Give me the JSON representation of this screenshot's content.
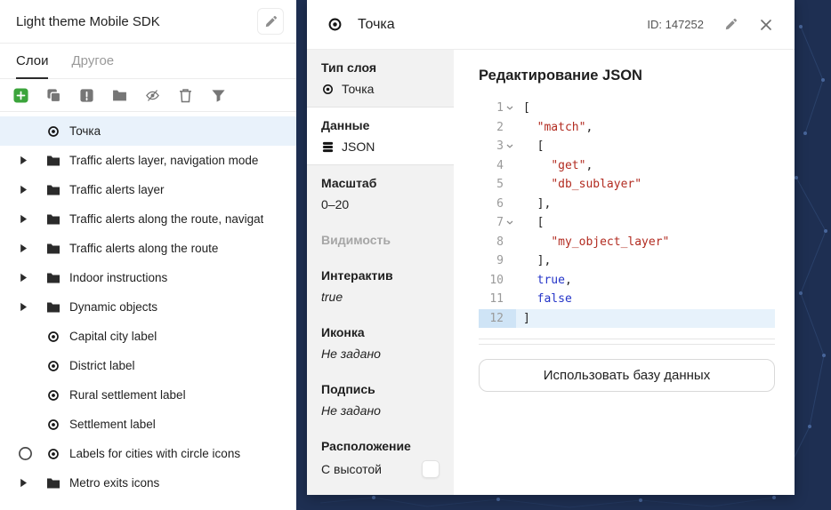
{
  "colors": {
    "bg": "#1e2f52",
    "selection": "#e9f2fb",
    "accent-green": "#3ba43b",
    "string": "#b22b20",
    "keyword": "#2434c8",
    "active-line": "#e7f2fb",
    "active-gutter": "#cfe4f6"
  },
  "left_panel": {
    "title": "Light theme Mobile SDK",
    "tabs": [
      {
        "name": "layers",
        "label": "Слои",
        "active": true
      },
      {
        "name": "other",
        "label": "Другое",
        "active": false
      }
    ],
    "toolbar_icons": [
      "add-icon",
      "duplicate-icon",
      "alert-square-icon",
      "group-folder-icon",
      "eye-off-icon",
      "trash-icon",
      "filter-icon"
    ],
    "layers": [
      {
        "type": "point",
        "label": "Точка",
        "selected": true
      },
      {
        "type": "folder",
        "label": "Traffic alerts layer, navigation mode"
      },
      {
        "type": "folder",
        "label": "Traffic alerts layer"
      },
      {
        "type": "folder",
        "label": "Traffic alerts along the route, navigat"
      },
      {
        "type": "folder",
        "label": "Traffic alerts along the route"
      },
      {
        "type": "folder",
        "label": "Indoor instructions"
      },
      {
        "type": "folder",
        "label": "Dynamic objects"
      },
      {
        "type": "point",
        "label": "Capital city label"
      },
      {
        "type": "point",
        "label": "District label"
      },
      {
        "type": "point",
        "label": "Rural settlement label"
      },
      {
        "type": "point",
        "label": "Settlement label"
      },
      {
        "type": "point",
        "label": "Labels for cities with circle icons",
        "outer_circle": true
      },
      {
        "type": "folder",
        "label": "Metro exits icons"
      }
    ]
  },
  "detail": {
    "header": {
      "title": "Точка",
      "id_label": "ID: 147252"
    },
    "properties": [
      {
        "key": "layer-type",
        "name": "Тип слоя",
        "value": "Точка",
        "value_icon": "point-icon",
        "divider": true
      },
      {
        "key": "data",
        "name": "Данные",
        "value": "JSON",
        "value_icon": "database-icon",
        "selected": true,
        "divider": true
      },
      {
        "key": "zoom",
        "name": "Масштаб",
        "value": "0–20"
      },
      {
        "key": "visibility",
        "name": "Видимость",
        "disabled": true
      },
      {
        "key": "interactive",
        "name": "Интерактив",
        "value": "true",
        "italic": true
      },
      {
        "key": "icon",
        "name": "Иконка",
        "value": "Не задано",
        "italic": true
      },
      {
        "key": "caption",
        "name": "Подпись",
        "value": "Не задано",
        "italic": true
      },
      {
        "key": "placement",
        "name": "Расположение",
        "value": "С высотой",
        "checkbox": true
      }
    ],
    "editor": {
      "title": "Редактирование JSON",
      "button_label": "Использовать базу данных",
      "lines": [
        {
          "n": 1,
          "fold": true,
          "indent": 0,
          "tokens": [
            {
              "t": "[",
              "c": "p"
            }
          ]
        },
        {
          "n": 2,
          "indent": 2,
          "tokens": [
            {
              "t": "\"match\"",
              "c": "s"
            },
            {
              "t": ",",
              "c": "p"
            }
          ]
        },
        {
          "n": 3,
          "fold": true,
          "indent": 2,
          "tokens": [
            {
              "t": "[",
              "c": "p"
            }
          ]
        },
        {
          "n": 4,
          "indent": 4,
          "tokens": [
            {
              "t": "\"get\"",
              "c": "s"
            },
            {
              "t": ",",
              "c": "p"
            }
          ]
        },
        {
          "n": 5,
          "indent": 4,
          "tokens": [
            {
              "t": "\"db_sublayer\"",
              "c": "s"
            }
          ]
        },
        {
          "n": 6,
          "indent": 2,
          "tokens": [
            {
              "t": "],",
              "c": "p"
            }
          ]
        },
        {
          "n": 7,
          "fold": true,
          "indent": 2,
          "tokens": [
            {
              "t": "[",
              "c": "p"
            }
          ]
        },
        {
          "n": 8,
          "indent": 4,
          "tokens": [
            {
              "t": "\"my_object_layer\"",
              "c": "s"
            }
          ]
        },
        {
          "n": 9,
          "indent": 2,
          "tokens": [
            {
              "t": "],",
              "c": "p"
            }
          ]
        },
        {
          "n": 10,
          "indent": 2,
          "tokens": [
            {
              "t": "true",
              "c": "k"
            },
            {
              "t": ",",
              "c": "p"
            }
          ]
        },
        {
          "n": 11,
          "indent": 2,
          "tokens": [
            {
              "t": "false",
              "c": "k"
            }
          ]
        },
        {
          "n": 12,
          "indent": 0,
          "active": true,
          "tokens": [
            {
              "t": "]",
              "c": "p"
            }
          ]
        }
      ]
    }
  }
}
